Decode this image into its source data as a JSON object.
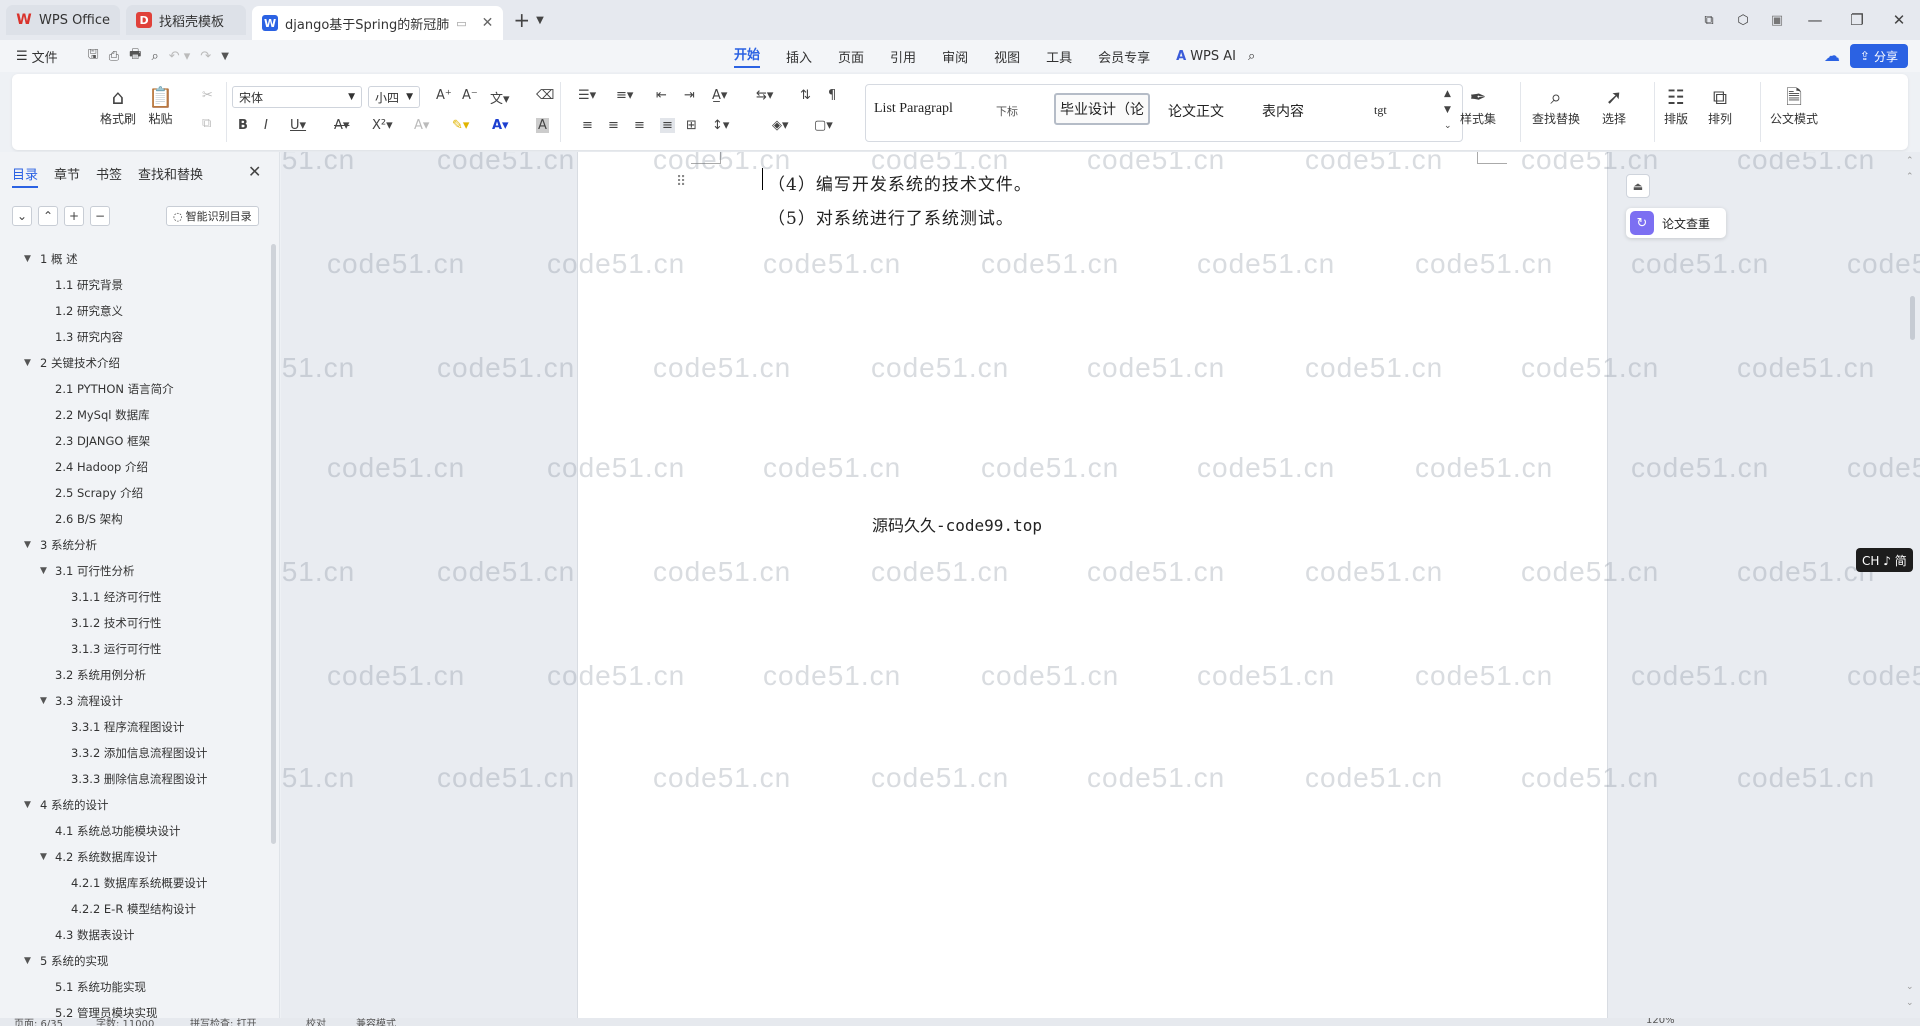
{
  "tabs": [
    {
      "label": "WPS Office",
      "icon": "wps-logo-icon",
      "color": "#d9332c"
    },
    {
      "label": "找稻壳模板",
      "icon": "docer-logo-icon",
      "color": "#e0413a"
    },
    {
      "label": "django基于Spring的新冠肺",
      "icon": "word-doc-icon",
      "color": "#2b62e3"
    }
  ],
  "menu": {
    "file_label": "文件",
    "ribbon_tabs": [
      "开始",
      "插入",
      "页面",
      "引用",
      "审阅",
      "视图",
      "工具",
      "会员专享"
    ],
    "active_tab": "开始",
    "wps_ai_label": "WPS AI",
    "share_label": "分享"
  },
  "ribbon": {
    "format_painter": "格式刷",
    "paste": "粘贴",
    "font_name": "宋体",
    "font_size": "小四",
    "styles": [
      "List Paragrapl",
      "下标",
      "毕业设计（论",
      "论文正文",
      "表内容",
      "tgt"
    ],
    "style_set": "样式集",
    "find_replace": "查找替换",
    "select": "选择",
    "layout": "排版",
    "arrange": "排列",
    "official_mode": "公文模式"
  },
  "sidepanel": {
    "tabs": [
      "目录",
      "章节",
      "书签",
      "查找和替换"
    ],
    "active_tab": "目录",
    "smart_toc": "智能识别目录",
    "toc": [
      {
        "level": 1,
        "label": "1    概    述",
        "expanded": true
      },
      {
        "level": 2,
        "label": "1.1 研究背景"
      },
      {
        "level": 2,
        "label": "1.2 研究意义"
      },
      {
        "level": 2,
        "label": "1.3 研究内容",
        "selected": true
      },
      {
        "level": 1,
        "label": "2    关键技术介绍",
        "expanded": true
      },
      {
        "level": 2,
        "label": "2.1 PYTHON 语言简介"
      },
      {
        "level": 2,
        "label": "2.2 MySql 数据库"
      },
      {
        "level": 2,
        "label": "2.3 DJANGO 框架"
      },
      {
        "level": 2,
        "label": "2.4 Hadoop 介绍"
      },
      {
        "level": 2,
        "label": "2.5 Scrapy 介绍"
      },
      {
        "level": 2,
        "label": "2.6 B/S 架构"
      },
      {
        "level": 1,
        "label": "3    系统分析",
        "expanded": true
      },
      {
        "level": 2,
        "label": "3.1 可行性分析",
        "expanded": true
      },
      {
        "level": 3,
        "label": "3.1.1 经济可行性"
      },
      {
        "level": 3,
        "label": "3.1.2 技术可行性"
      },
      {
        "level": 3,
        "label": "3.1.3 运行可行性"
      },
      {
        "level": 2,
        "label": "3.2 系统用例分析"
      },
      {
        "level": 2,
        "label": "3.3 流程设计",
        "expanded": true
      },
      {
        "level": 3,
        "label": "3.3.1 程序流程图设计"
      },
      {
        "level": 3,
        "label": "3.3.2 添加信息流程图设计"
      },
      {
        "level": 3,
        "label": "3.3.3 删除信息流程图设计"
      },
      {
        "level": 1,
        "label": "4    系统的设计",
        "expanded": true
      },
      {
        "level": 2,
        "label": "4.1 系统总功能模块设计"
      },
      {
        "level": 2,
        "label": "4.2 系统数据库设计",
        "expanded": true
      },
      {
        "level": 3,
        "label": "4.2.1 数据库系统概要设计"
      },
      {
        "level": 3,
        "label": "4.2.2 E-R 模型结构设计"
      },
      {
        "level": 2,
        "label": "4.3 数据表设计"
      },
      {
        "level": 1,
        "label": "5    系统的实现",
        "expanded": true
      },
      {
        "level": 2,
        "label": "5.1 系统功能实现"
      },
      {
        "level": 2,
        "label": "5.2 管理员模块实现"
      }
    ]
  },
  "document": {
    "lines": [
      "（4）编写开发系统的技术文件。",
      "（5）对系统进行了系统测试。"
    ],
    "center_text": "源码久久-code99.top",
    "watermark": "code51.cn"
  },
  "right_tools": {
    "paper_check": "论文查重",
    "ime": "CH ♪ 简"
  },
  "status": {
    "page": "页面: 6/35",
    "words": "字数: 11000",
    "spell": "拼写检查: 打开",
    "proof": "校对",
    "compat": "兼容模式",
    "zoom": "120%"
  }
}
